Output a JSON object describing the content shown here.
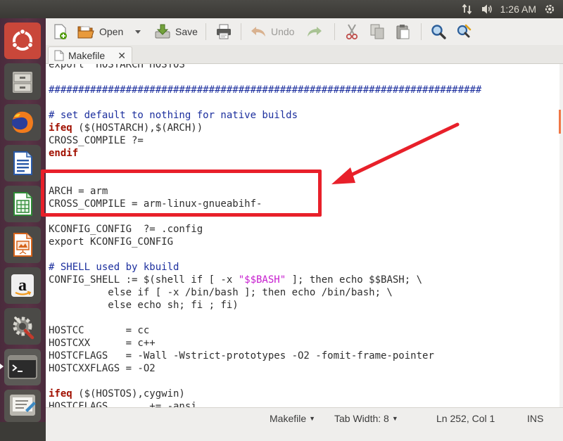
{
  "top_panel": {
    "clock": "1:26 AM",
    "indicators": [
      "network-transfer-icon",
      "volume-icon",
      "power-gear-icon"
    ]
  },
  "launcher": {
    "items": [
      {
        "name": "ubuntu-dash-icon"
      },
      {
        "name": "files-cabinet-icon"
      },
      {
        "name": "firefox-icon"
      },
      {
        "name": "libreoffice-writer-icon"
      },
      {
        "name": "libreoffice-calc-icon"
      },
      {
        "name": "libreoffice-impress-icon"
      },
      {
        "name": "amazon-icon"
      },
      {
        "name": "system-settings-icon"
      },
      {
        "name": "terminal-icon"
      },
      {
        "name": "text-editor-icon"
      }
    ]
  },
  "toolbar": {
    "open_label": "Open",
    "save_label": "Save",
    "undo_label": "Undo"
  },
  "tabs": [
    {
      "label": "Makefile",
      "close": "✕"
    }
  ],
  "editor": {
    "lines": [
      {
        "segments": [
          {
            "t": "export  HOSTARCH HOSTOS",
            "c": ""
          }
        ]
      },
      {
        "segments": [
          {
            "t": "",
            "c": ""
          }
        ]
      },
      {
        "segments": [
          {
            "t": "#########################################################################",
            "c": "comment"
          }
        ]
      },
      {
        "segments": [
          {
            "t": "",
            "c": ""
          }
        ]
      },
      {
        "segments": [
          {
            "t": "# set default to nothing for native builds",
            "c": "comment"
          }
        ]
      },
      {
        "segments": [
          {
            "t": "ifeq",
            "c": "kw"
          },
          {
            "t": " ($(HOSTARCH),$(ARCH))",
            "c": ""
          }
        ]
      },
      {
        "segments": [
          {
            "t": "CROSS_COMPILE ?=",
            "c": ""
          }
        ]
      },
      {
        "segments": [
          {
            "t": "endif",
            "c": "kw"
          }
        ]
      },
      {
        "segments": [
          {
            "t": "",
            "c": ""
          }
        ]
      },
      {
        "segments": [
          {
            "t": "",
            "c": ""
          }
        ]
      },
      {
        "segments": [
          {
            "t": "ARCH = arm",
            "c": ""
          }
        ]
      },
      {
        "segments": [
          {
            "t": "CROSS_COMPILE = arm-linux-gnueabihf-",
            "c": ""
          }
        ]
      },
      {
        "segments": [
          {
            "t": "",
            "c": ""
          }
        ]
      },
      {
        "segments": [
          {
            "t": "KCONFIG_CONFIG  ?= .config",
            "c": ""
          }
        ]
      },
      {
        "segments": [
          {
            "t": "export KCONFIG_CONFIG",
            "c": ""
          }
        ]
      },
      {
        "segments": [
          {
            "t": "",
            "c": ""
          }
        ]
      },
      {
        "segments": [
          {
            "t": "# SHELL used by kbuild",
            "c": "comment"
          }
        ]
      },
      {
        "segments": [
          {
            "t": "CONFIG_SHELL := $(shell if [ -x ",
            "c": ""
          },
          {
            "t": "\"$$BASH\"",
            "c": "str"
          },
          {
            "t": " ]; then echo $$BASH; \\",
            "c": ""
          }
        ]
      },
      {
        "segments": [
          {
            "t": "          else if [ -x /bin/bash ]; then echo /bin/bash; \\",
            "c": ""
          }
        ]
      },
      {
        "segments": [
          {
            "t": "          else echo sh; fi ; fi)",
            "c": ""
          }
        ]
      },
      {
        "segments": [
          {
            "t": "",
            "c": ""
          }
        ]
      },
      {
        "segments": [
          {
            "t": "HOSTCC       = cc",
            "c": ""
          }
        ]
      },
      {
        "segments": [
          {
            "t": "HOSTCXX      = c++",
            "c": ""
          }
        ]
      },
      {
        "segments": [
          {
            "t": "HOSTCFLAGS   = -Wall -Wstrict-prototypes -O2 -fomit-frame-pointer",
            "c": ""
          }
        ]
      },
      {
        "segments": [
          {
            "t": "HOSTCXXFLAGS = -O2",
            "c": ""
          }
        ]
      },
      {
        "segments": [
          {
            "t": "",
            "c": ""
          }
        ]
      },
      {
        "segments": [
          {
            "t": "ifeq",
            "c": "kw"
          },
          {
            "t": " ($(HOSTOS),cygwin)",
            "c": ""
          }
        ]
      },
      {
        "segments": [
          {
            "t": "HOSTCFLAGS       += -ansi",
            "c": ""
          }
        ]
      }
    ]
  },
  "statusbar": {
    "language": "Makefile",
    "tab_width": "Tab Width: 8",
    "position": "Ln 252, Col 1",
    "mode": "INS"
  },
  "colors": {
    "highlight": "#e8202a",
    "comment": "#1c2f9e",
    "keyword": "#a11000",
    "string": "#c71ecf"
  }
}
